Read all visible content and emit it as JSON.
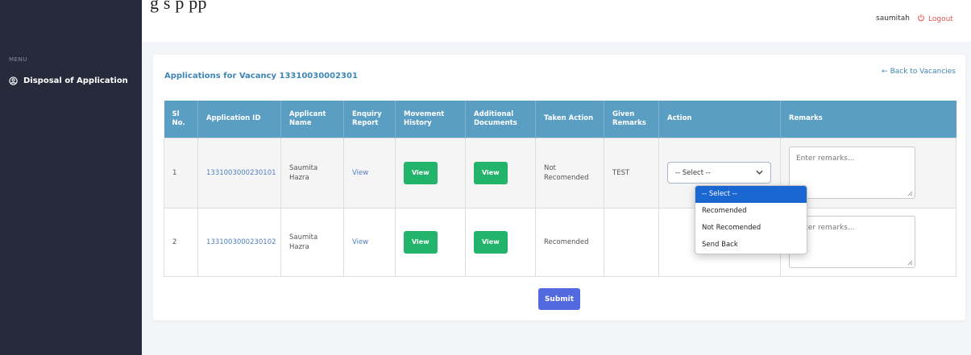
{
  "caption_fragment": "g                                                   s  p              pp",
  "topbar": {
    "username": "saumitah",
    "logout_label": "Logout"
  },
  "sidebar": {
    "menu_label": "MENU",
    "items": [
      {
        "label": "Disposal of Application",
        "icon": "user-circle-icon"
      }
    ]
  },
  "card": {
    "title": "Applications for Vacancy 13310030002301",
    "back_link": "← Back to Vacancies"
  },
  "table": {
    "headers": [
      "Sl No.",
      "Application ID",
      "Applicant Name",
      "Enquiry Report",
      "Movement History",
      "Additional Documents",
      "Taken Action",
      "Given Remarks",
      "Action",
      "Remarks"
    ],
    "rows": [
      {
        "sl": "1",
        "application_id": "1331003000230101",
        "applicant_name": "Saumita Hazra",
        "enquiry_report": "View",
        "movement_history": "View",
        "additional_documents": "View",
        "taken_action": "Not Recomended",
        "given_remarks": "TEST",
        "action_selected": "-- Select --",
        "remarks_placeholder": "Enter remarks..."
      },
      {
        "sl": "2",
        "application_id": "1331003000230102",
        "applicant_name": "Saumita Hazra",
        "enquiry_report": "View",
        "movement_history": "View",
        "additional_documents": "View",
        "taken_action": "Recomended",
        "given_remarks": "",
        "action_selected": "",
        "remarks_placeholder": "Enter remarks..."
      }
    ]
  },
  "dropdown": {
    "options": [
      "-- Select --",
      "Recomended",
      "Not Recomended",
      "Send Back"
    ],
    "selected_index": 0
  },
  "submit_label": "Submit",
  "colors": {
    "sidebar_bg": "#262b3c",
    "table_header": "#5a9ec3",
    "green_button": "#22b46b",
    "submit_button": "#5369e0",
    "logout": "#e2574c",
    "link": "#3e86b5",
    "dropdown_selected": "#1b67d2"
  }
}
